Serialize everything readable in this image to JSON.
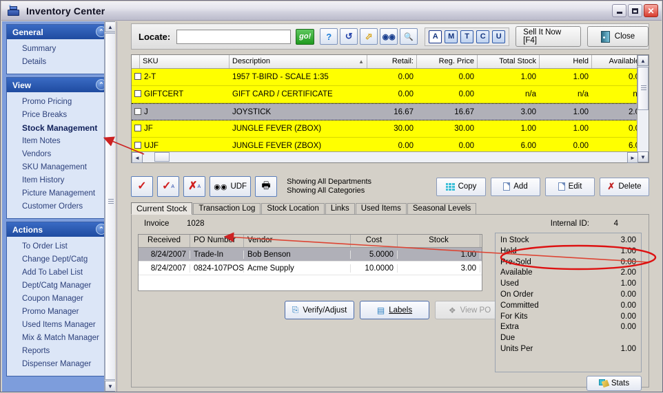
{
  "window": {
    "title": "Inventory Center",
    "icon": "cash-register-icon",
    "minimize": "–",
    "maximize": "□",
    "close": "✕"
  },
  "sidebar": {
    "groups": [
      {
        "title": "General",
        "collapse_icon": "chevron-up-icon",
        "items": [
          "Summary",
          "Details"
        ]
      },
      {
        "title": "View",
        "collapse_icon": "chevron-up-icon",
        "items": [
          "Promo Pricing",
          "Price Breaks",
          "Stock Management",
          "Item Notes",
          "Vendors",
          "SKU Management",
          "Item History",
          "Picture Management",
          "Customer Orders"
        ],
        "active": "Stock Management"
      },
      {
        "title": "Actions",
        "collapse_icon": "chevron-up-icon",
        "items": [
          "To Order List",
          "Change Dept/Catg",
          "Add To Label List",
          "Dept/Catg Manager",
          "Coupon Manager",
          "Promo Manager",
          "Used Items Manager",
          "Mix & Match Manager",
          "Reports",
          "Dispenser Manager"
        ]
      }
    ]
  },
  "toolbar": {
    "locate_label": "Locate:",
    "locate_value": "",
    "locate_placeholder": "",
    "go_label": "go!",
    "icons": [
      "help-icon",
      "refresh-icon",
      "jump-icon",
      "binoculars-icon",
      "preview-icon"
    ],
    "letters": [
      "A",
      "M",
      "T",
      "C",
      "U"
    ],
    "selected_letter": "A",
    "sell_now_label": "Sell It Now [F4]",
    "close_label": "Close"
  },
  "grid": {
    "columns": [
      "SKU",
      "Description",
      "Retail:",
      "Reg. Price",
      "Total Stock",
      "Held",
      "Available"
    ],
    "sort_column": "Description",
    "sort_icon": "sort-asc-icon",
    "rows": [
      {
        "sku": "2-T",
        "description": "1957 T-BIRD - SCALE 1:35",
        "retail": "0.00",
        "reg_price": "0.00",
        "total_stock": "1.00",
        "held": "1.00",
        "available": "0.0",
        "selected": false
      },
      {
        "sku": "GIFTCERT",
        "description": "GIFT CARD / CERTIFICATE",
        "retail": "0.00",
        "reg_price": "0.00",
        "total_stock": "n/a",
        "held": "n/a",
        "available": "n/",
        "selected": false
      },
      {
        "sku": "J",
        "description": "JOYSTICK",
        "retail": "16.67",
        "reg_price": "16.67",
        "total_stock": "3.00",
        "held": "1.00",
        "available": "2.0",
        "selected": true
      },
      {
        "sku": "JF",
        "description": "JUNGLE FEVER (ZBOX)",
        "retail": "30.00",
        "reg_price": "30.00",
        "total_stock": "1.00",
        "held": "1.00",
        "available": "0.0",
        "selected": false
      },
      {
        "sku": "UJF",
        "description": "JUNGLE FEVER (ZBOX)",
        "retail": "0.00",
        "reg_price": "0.00",
        "total_stock": "6.00",
        "held": "0.00",
        "available": "6.0",
        "selected": false
      }
    ]
  },
  "actions": {
    "check_one": "check-icon",
    "check_all": "check-all-icon",
    "uncheck_all": "uncheck-all-icon",
    "udf_label": "UDF",
    "udf_icon": "binoculars-icon",
    "print_icon": "printer-icon",
    "showing_departments": "Showing All Departments",
    "showing_categories": "Showing All Categories",
    "copy_label": "Copy",
    "add_label": "Add",
    "edit_label": "Edit",
    "delete_label": "Delete"
  },
  "tabs": {
    "items": [
      "Current Stock",
      "Transaction Log",
      "Stock Location",
      "Links",
      "Used Items",
      "Seasonal Levels"
    ],
    "active": "Current Stock"
  },
  "detail": {
    "invoice_label": "Invoice",
    "invoice_value": "1028",
    "internal_id_label": "Internal ID:",
    "internal_id_value": "4",
    "columns": [
      "Received",
      "PO Number",
      "Vendor",
      "Cost",
      "Stock"
    ],
    "rows": [
      {
        "received": "8/24/2007",
        "po_number": "Trade-In",
        "vendor": "Bob Benson",
        "cost": "5.0000",
        "stock": "1.00",
        "selected": true
      },
      {
        "received": "8/24/2007",
        "po_number": "0824-107POS",
        "vendor": "Acme Supply",
        "cost": "10.0000",
        "stock": "3.00",
        "selected": false
      }
    ],
    "verify_label": "Verify/Adjust",
    "labels_label": "Labels",
    "view_po_label": "View PO",
    "view_po_disabled": true
  },
  "stats": {
    "rows": [
      {
        "label": "In Stock",
        "value": "3.00"
      },
      {
        "label": "Held",
        "value": "1.00"
      },
      {
        "label": "Pre-Sold",
        "value": "0.00"
      },
      {
        "label": "Available",
        "value": "2.00"
      },
      {
        "label": "Used",
        "value": "1.00",
        "highlighted": true
      },
      {
        "label": "On Order",
        "value": "0.00"
      },
      {
        "label": "Committed",
        "value": "0.00"
      },
      {
        "label": "For Kits",
        "value": "0.00"
      },
      {
        "label": "Extra",
        "value": "0.00"
      },
      {
        "label": "Due",
        "value": ""
      },
      {
        "label": "Units Per",
        "value": "1.00"
      }
    ],
    "stats_button": "Stats"
  },
  "annotations": {
    "arrow_color": "#cc2222",
    "ellipse_color": "#dd1111",
    "notes": [
      "arrow-to-stock-management",
      "arrow-to-trade-in-row",
      "ellipse-around-used-row"
    ]
  }
}
